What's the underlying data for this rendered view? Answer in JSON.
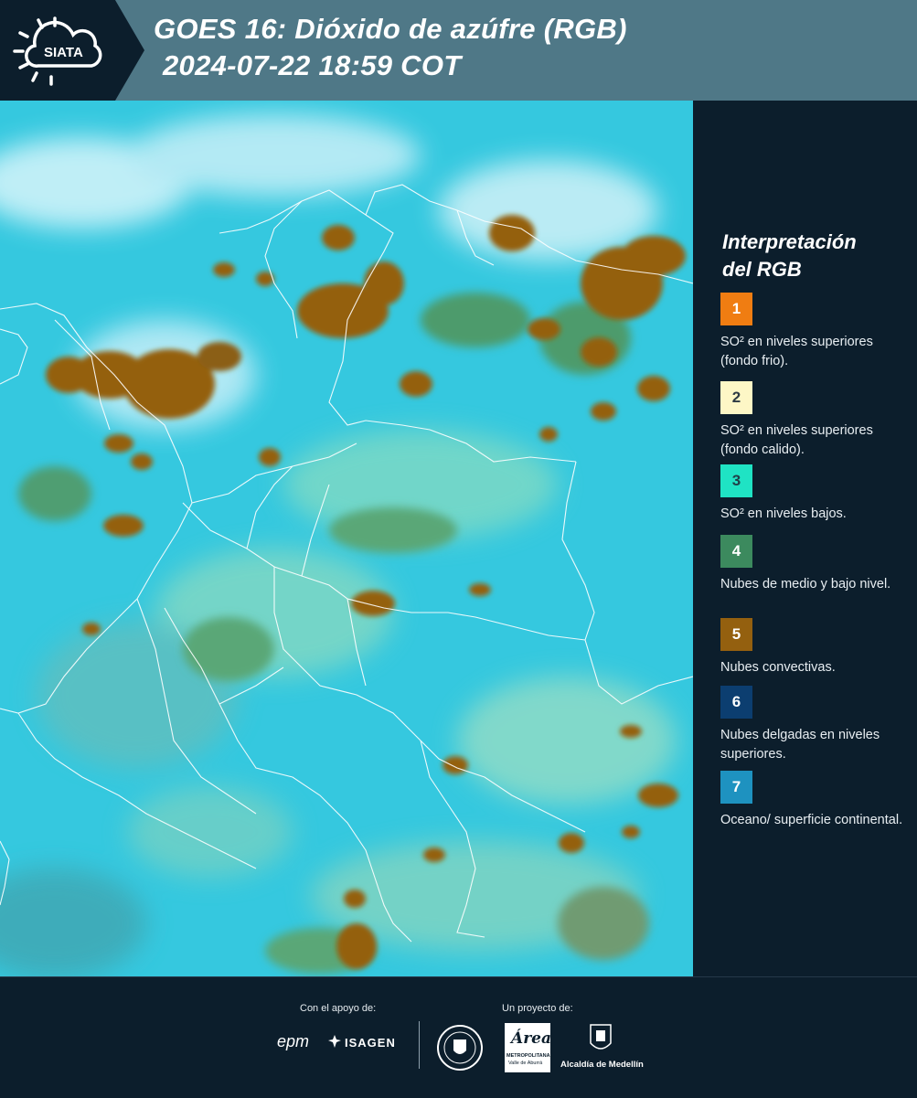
{
  "header": {
    "logo_text": "SIATA",
    "title_line1": "GOES 16: Dióxido de azúfre (RGB)",
    "title_line2": "2024-07-22 18:59 COT"
  },
  "legend": {
    "title_line1": "Interpretación",
    "title_line2": "del RGB",
    "items": [
      {
        "number": "1",
        "label": "SO² en niveles superiores (fondo frio).",
        "color": "#f07d12",
        "text_color": "#ffffff"
      },
      {
        "number": "2",
        "label": "SO² en niveles superiores (fondo calido).",
        "color": "#fdf7c6",
        "text_color": "#2d3a44"
      },
      {
        "number": "3",
        "label": "SO² en niveles bajos.",
        "color": "#1fe3c4",
        "text_color": "#204048"
      },
      {
        "number": "4",
        "label": "Nubes de medio y bajo nivel.",
        "color": "#3c8a5e",
        "text_color": "#ffffff"
      },
      {
        "number": "5",
        "label": "Nubes convectivas.",
        "color": "#94600f",
        "text_color": "#ffffff"
      },
      {
        "number": "6",
        "label": "Nubes delgadas en niveles superiores.",
        "color": "#0c3e70",
        "text_color": "#ffffff"
      },
      {
        "number": "7",
        "label": "Oceano/ superficie continental.",
        "color": "#1e92c0",
        "text_color": "#ffffff"
      }
    ]
  },
  "footer": {
    "support_label": "Con el apoyo de:",
    "project_label": "Un proyecto de:",
    "epm": "epm",
    "isagen": "ISAGEN",
    "area_name": "Área",
    "area_sub1": "METROPOLITANA",
    "area_sub2": "Valle de Aburrá",
    "alcaldia": "Alcaldía de Medellín"
  },
  "colors": {
    "header_bg": "#4f7887",
    "dark_bg": "#0c1e2c",
    "ocean_cyan": "#35c8df",
    "convective": "#94600f",
    "mid_low": "#3c8a5e"
  }
}
